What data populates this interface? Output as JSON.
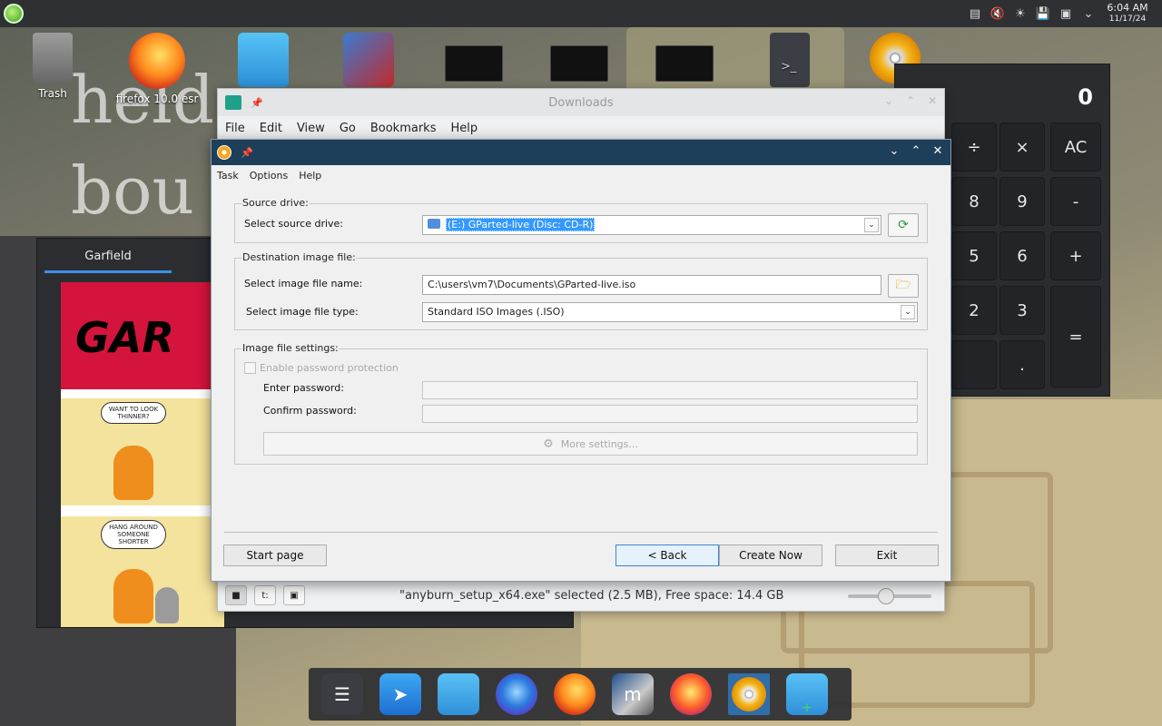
{
  "desktop": {
    "wallpaper_text": [
      "held",
      "bou"
    ],
    "icons": [
      {
        "id": "trash",
        "label": "Trash"
      },
      {
        "id": "firefox",
        "label": "firefox 10.0 esr"
      },
      {
        "id": "home",
        "label": ""
      },
      {
        "id": "dino",
        "label": ""
      },
      {
        "id": "vmware1",
        "label": ""
      },
      {
        "id": "vmware2",
        "label": ""
      },
      {
        "id": "vmware3",
        "label": ""
      },
      {
        "id": "terminal",
        "label": ">_"
      },
      {
        "id": "disc",
        "label": ""
      }
    ]
  },
  "top_panel": {
    "time": "6:04 AM",
    "date": "11/17/24",
    "tray_icons": [
      "clipboard-icon",
      "mute-icon",
      "brightness-icon",
      "save-icon",
      "network-icon",
      "chevron-down-icon"
    ]
  },
  "calculator": {
    "display": "0",
    "buttons": [
      "÷",
      "×",
      "AC",
      "8",
      "9",
      "-",
      "5",
      "6",
      "+",
      "2",
      "3",
      "=",
      ".",
      ""
    ]
  },
  "garfield": {
    "tab_label": "Garfield",
    "strip_title": "GAR",
    "bubble1": "WANT TO LOOK THINNER?",
    "bubble2": "HANG AROUND SOMEONE SHORTER"
  },
  "downloads": {
    "title": "Downloads",
    "menu": [
      "File",
      "Edit",
      "View",
      "Go",
      "Bookmarks",
      "Help"
    ],
    "status": "\"anyburn_setup_x64.exe\" selected (2.5 MB), Free space: 14.4 GB",
    "zoom_level": 0.45
  },
  "anyburn": {
    "menu": {
      "task": "Task",
      "options": "Options",
      "help": "Help"
    },
    "source": {
      "legend": "Source drive:",
      "label": "Select source drive:",
      "value": "(E:) GParted-live (Disc: CD-R)"
    },
    "destination": {
      "legend": "Destination image file:",
      "name_label": "Select image file name:",
      "name_value": "C:\\users\\vm7\\Documents\\GParted-live.iso",
      "type_label": "Select image file type:",
      "type_value": "Standard ISO Images (.ISO)"
    },
    "settings": {
      "legend": "Image file settings:",
      "enable_pw": "Enable password protection",
      "enter_pw": "Enter password:",
      "confirm_pw": "Confirm password:",
      "enter_pw_value": "",
      "confirm_pw_value": "",
      "more": "More settings..."
    },
    "buttons": {
      "start_page": "Start page",
      "back": "< Back",
      "create_now": "Create Now",
      "exit": "Exit"
    }
  },
  "dock": {
    "items": [
      "settings-icon",
      "store-icon",
      "files-icon",
      "firefox-developer-icon",
      "firefox-icon",
      "editor-icon",
      "firefox-nightly-icon",
      "anyburn-icon",
      "new-folder-icon"
    ]
  }
}
